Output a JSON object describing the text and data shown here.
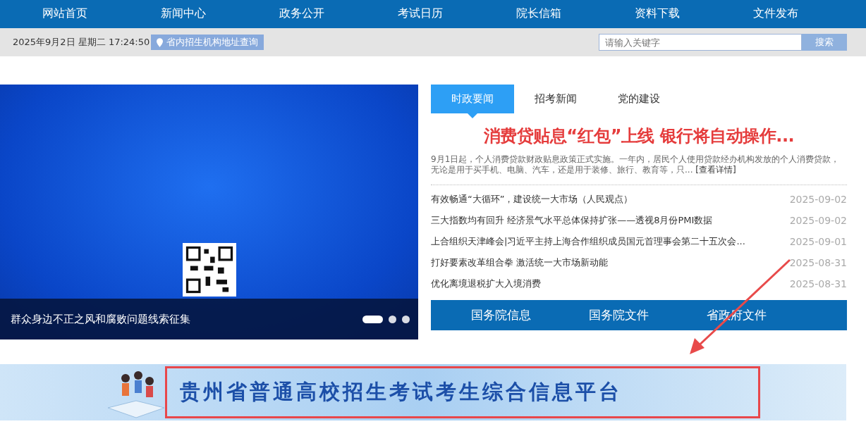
{
  "nav": [
    "网站首页",
    "新闻中心",
    "政务公开",
    "考试日历",
    "院长信箱",
    "资料下载",
    "文件发布"
  ],
  "top_bar": {
    "datetime": "2025年9月2日 星期二 17:24:50",
    "address_link": "省内招生机构地址查询",
    "search": {
      "placeholder": "请输入关键字",
      "button": "搜索"
    }
  },
  "slider": {
    "caption": "群众身边不正之风和腐败问题线索征集",
    "dots": [
      {
        "selected": true
      },
      {
        "selected": false
      },
      {
        "selected": false
      }
    ]
  },
  "news": {
    "tabs": [
      {
        "label": "时政要闻",
        "selected": true
      },
      {
        "label": "招考新闻",
        "selected": false
      },
      {
        "label": "党的建设",
        "selected": false
      }
    ],
    "headline": "消费贷贴息“红包”上线 银行将自动操作...",
    "summary": "9月1日起，个人消费贷款财政贴息政策正式实施。一年内，居民个人使用贷款经办机构发放的个人消费贷款，无论是用于买手机、电脑、汽车，还是用于装修、旅行、教育等，只...",
    "more_link": "[查看详情]",
    "items": [
      {
        "title": "有效畅通“大循环”，建设统一大市场（人民观点）",
        "date": "2025-09-02"
      },
      {
        "title": "三大指数均有回升 经济景气水平总体保持扩张——透视8月份PMI数据",
        "date": "2025-09-02"
      },
      {
        "title": "上合组织天津峰会|习近平主持上海合作组织成员国元首理事会第二十五次会...",
        "date": "2025-09-01"
      },
      {
        "title": "打好要素改革组合拳 激活统一大市场新动能",
        "date": "2025-08-31"
      },
      {
        "title": "优化离境退税扩大入境消费",
        "date": "2025-08-31"
      }
    ],
    "links": [
      "国务院信息",
      "国务院文件",
      "省政府文件"
    ]
  },
  "banner": {
    "title": "贵州省普通高校招生考试考生综合信息平台"
  }
}
